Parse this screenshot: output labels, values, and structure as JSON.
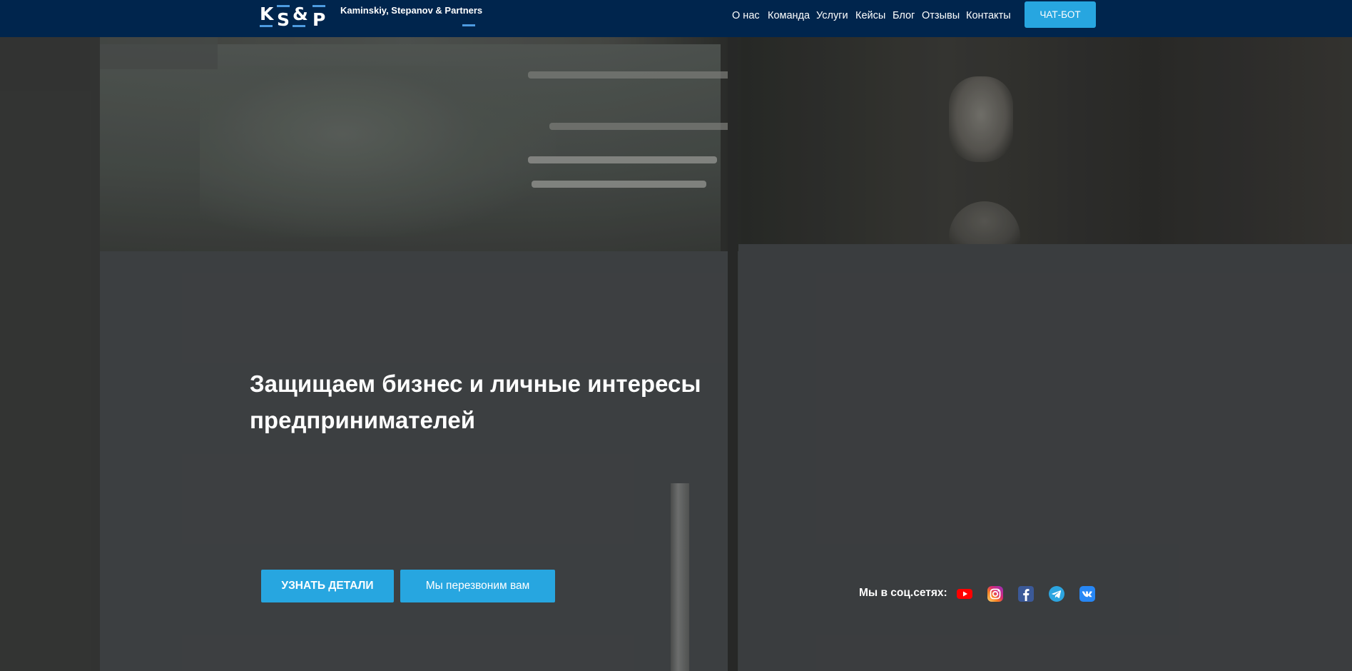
{
  "header": {
    "logo": {
      "letters": [
        "K",
        "S",
        "&",
        "P"
      ],
      "company_name": "Kaminskiy, Stepanov & Partners"
    },
    "nav": [
      "О нас",
      "Команда",
      "Услуги",
      "Кейсы",
      "Блог",
      "Отзывы",
      "Контакты"
    ],
    "chat_button": "ЧАТ-БОТ"
  },
  "hero": {
    "headline_line1": "Защищаем бизнес и личные интересы",
    "headline_line2": "предпринимателей",
    "details_button": "УЗНАТЬ ДЕТАЛИ",
    "callback_button": "Мы перезвоним вам"
  },
  "social": {
    "label": "Мы в соц.сетях:",
    "icons": [
      "youtube-icon",
      "instagram-icon",
      "facebook-icon",
      "telegram-icon",
      "vk-icon"
    ]
  },
  "colors": {
    "header_bg": "#00254d",
    "accent": "#27a6e0",
    "logo_accent": "#4d9be0",
    "youtube": "#ff0000",
    "instagram": "#c13584",
    "facebook": "#3b5998",
    "telegram": "#2ca5e0",
    "vk": "#2787f5"
  }
}
